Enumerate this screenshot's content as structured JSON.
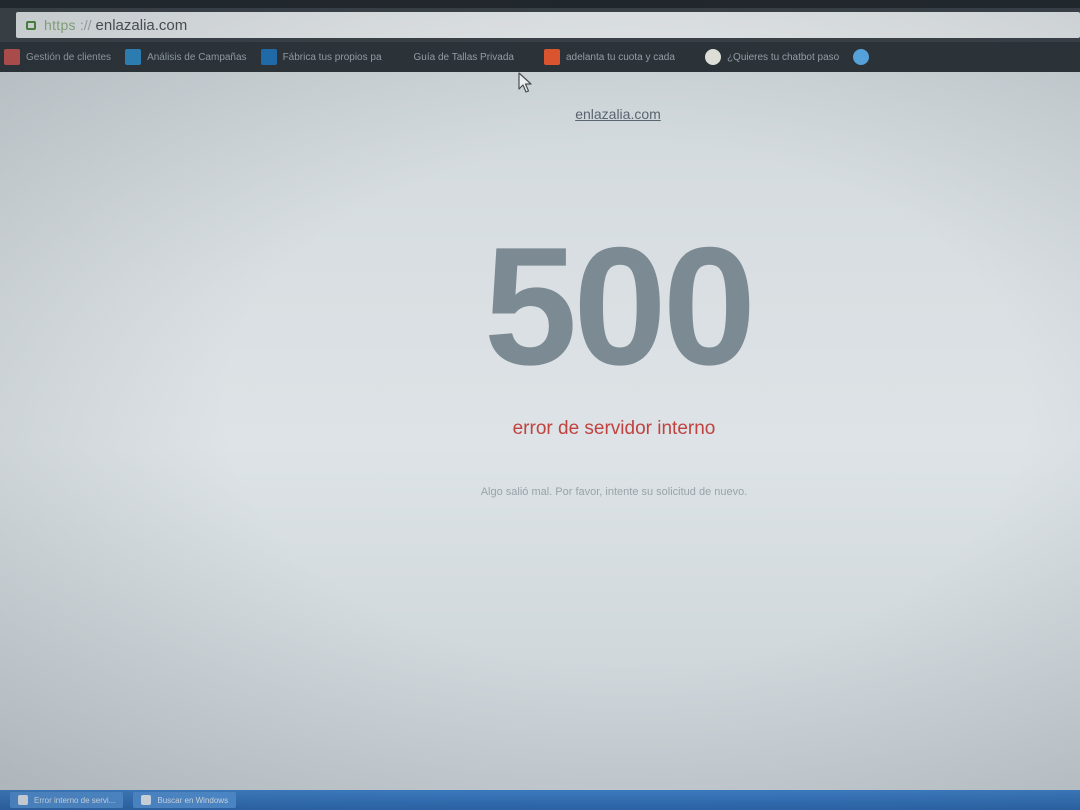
{
  "browser": {
    "url_scheme": "https",
    "url_host": "enlazalia.com"
  },
  "bookmarks": [
    {
      "icon": "globe-icon",
      "color": "#c0504d",
      "label": "Gestión de clientes"
    },
    {
      "icon": "app-icon",
      "color": "#2e86c1",
      "label": "Análisis de Campañas"
    },
    {
      "icon": "trello-icon",
      "color": "#1f6fb2",
      "label": "Fábrica tus propios pa"
    },
    {
      "icon": "page-icon",
      "color": "#2b3238",
      "label": "Guía de Tallas Privada"
    },
    {
      "icon": "blogger-icon",
      "color": "#e4572e",
      "label": "adelanta tu cuota y cada"
    },
    {
      "icon": "chat-icon",
      "color": "#e8e8e0",
      "label": "¿Quieres tu chatbot paso"
    },
    {
      "icon": "globe-icon",
      "color": "#5aa9e6",
      "label": ""
    }
  ],
  "page": {
    "site_link": "enlazalia.com",
    "error_code": "500",
    "error_title": "error de servidor interno",
    "error_message": "Algo salió mal. Por favor, intente su solicitud de nuevo."
  },
  "taskbar": {
    "items": [
      {
        "label": "Error interno de servi..."
      },
      {
        "label": "Buscar en Windows"
      }
    ]
  },
  "colors": {
    "error_code": "#7c8a93",
    "error_title": "#c0433f",
    "background": "#dde3e6"
  }
}
